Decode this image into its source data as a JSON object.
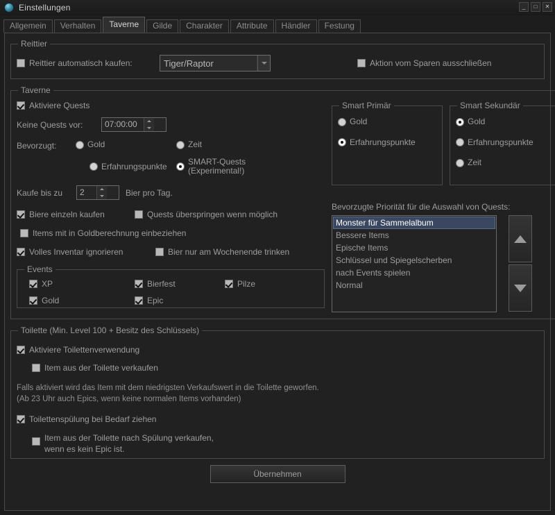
{
  "window": {
    "title": "Einstellungen",
    "icon": "globe-icon",
    "controls": {
      "minimize": "_",
      "maximize": "□",
      "close": "✕"
    }
  },
  "tabs": [
    {
      "label": "Allgemein",
      "active": false
    },
    {
      "label": "Verhalten",
      "active": false
    },
    {
      "label": "Taverne",
      "active": true
    },
    {
      "label": "Gilde",
      "active": false
    },
    {
      "label": "Charakter",
      "active": false
    },
    {
      "label": "Attribute",
      "active": false
    },
    {
      "label": "Händler",
      "active": false
    },
    {
      "label": "Festung",
      "active": false
    }
  ],
  "mount": {
    "legend": "Reittier",
    "auto_buy_label": "Reittier automatisch kaufen:",
    "auto_buy_checked": false,
    "mount_select_value": "Tiger/Raptor",
    "exclude_saving_label": "Aktion vom Sparen ausschließen",
    "exclude_saving_checked": false
  },
  "tavern": {
    "legend": "Taverne",
    "enable_quests_label": "Aktiviere Quests",
    "enable_quests_checked": true,
    "no_quests_before_label": "Keine Quests vor:",
    "no_quests_before_value": "07:00:00",
    "preferred_label": "Bevorzugt:",
    "preferred_options": [
      {
        "label": "Gold",
        "selected": false
      },
      {
        "label": "Zeit",
        "selected": false
      },
      {
        "label": "Erfahrungspunkte",
        "selected": false
      },
      {
        "label": "SMART-Quests\n(Experimental!)",
        "line1": "SMART-Quests",
        "line2": "(Experimental!)",
        "selected": true
      }
    ],
    "buy_up_to_label": "Kaufe bis zu",
    "buy_up_to_value": "2",
    "beer_per_day_label": "Bier pro Tag.",
    "checks": [
      {
        "label": "Biere einzeln kaufen",
        "checked": true
      },
      {
        "label": "Quests überspringen wenn möglich",
        "checked": false
      },
      {
        "label": "Items mit in Goldberechnung einbeziehen",
        "checked": false
      },
      {
        "label": "Volles Inventar ignorieren",
        "checked": true
      },
      {
        "label": "Bier nur am Wochenende trinken",
        "checked": false
      }
    ]
  },
  "smart_primary": {
    "legend": "Smart Primär",
    "options": [
      {
        "label": "Gold",
        "selected": false
      },
      {
        "label": "Erfahrungspunkte",
        "selected": true
      }
    ]
  },
  "smart_secondary": {
    "legend": "Smart Sekundär",
    "options": [
      {
        "label": "Gold",
        "selected": true
      },
      {
        "label": "Erfahrungspunkte",
        "selected": false
      },
      {
        "label": "Zeit",
        "selected": false
      }
    ]
  },
  "events": {
    "legend": "Events",
    "items": [
      {
        "label": "XP",
        "checked": true
      },
      {
        "label": "Bierfest",
        "checked": true
      },
      {
        "label": "Pilze",
        "checked": true
      },
      {
        "label": "Gold",
        "checked": true
      },
      {
        "label": "Epic",
        "checked": true
      }
    ]
  },
  "quest_priority": {
    "title": "Bevorzugte Priorität für die Auswahl von Quests:",
    "items": [
      {
        "label": "Monster für Sammelalbum",
        "selected": true
      },
      {
        "label": "Bessere Items",
        "selected": false
      },
      {
        "label": "Epische Items",
        "selected": false
      },
      {
        "label": "Schlüssel und Spiegelscherben",
        "selected": false
      },
      {
        "label": "nach Events spielen",
        "selected": false
      },
      {
        "label": "Normal",
        "selected": false
      }
    ],
    "move_up_icon": "arrow-up-icon",
    "move_down_icon": "arrow-down-icon"
  },
  "toilet": {
    "legend": "Toilette (Min. Level 100 + Besitz des Schlüssels)",
    "enable_label": "Aktiviere Toilettenverwendung",
    "enable_checked": true,
    "sell_item_label": "Item aus der Toilette verkaufen",
    "sell_item_checked": false,
    "note_line1": "Falls aktiviert wird das Item mit dem niedrigsten Verkaufswert in die Toilette geworfen.",
    "note_line2": "(Ab 23 Uhr auch Epics, wenn keine normalen Items vorhanden)",
    "flush_label": "Toilettenspülung bei Bedarf ziehen",
    "flush_checked": true,
    "sell_after_flush_line1": "Item aus der Toilette nach Spülung verkaufen,",
    "sell_after_flush_line2": "wenn es kein Epic ist.",
    "sell_after_flush_checked": false
  },
  "footer": {
    "apply_label": "Übernehmen"
  },
  "colors": {
    "background": "#212121",
    "accent_selection": "#3a4760",
    "text": "#9d9d9d"
  }
}
